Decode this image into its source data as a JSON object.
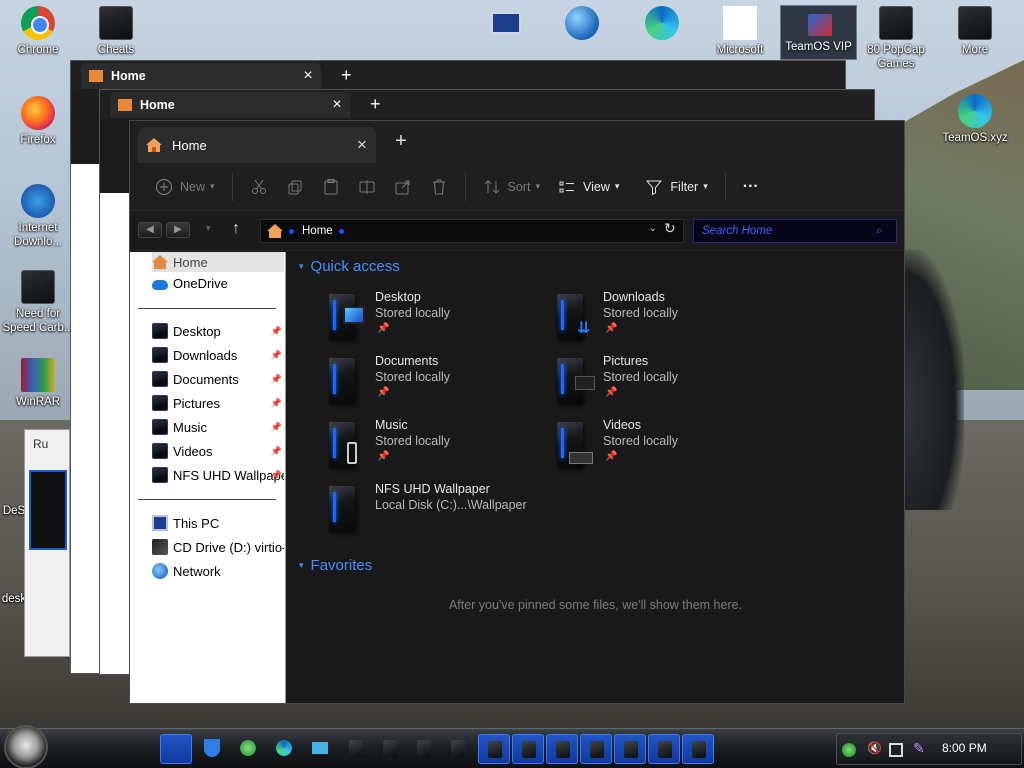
{
  "desktop": {
    "icons": [
      {
        "label": "Chrome",
        "glyph": "chrome"
      },
      {
        "label": "Cheats",
        "glyph": "pc"
      },
      {
        "label": "Firefox",
        "glyph": "ff"
      },
      {
        "label": "Internet Downlo...",
        "glyph": "ie"
      },
      {
        "label": "Need for Speed Carb...",
        "glyph": "pc"
      },
      {
        "label": "WinRAR",
        "glyph": "winrar"
      },
      {
        "label": "DeS",
        "glyph": "pc"
      },
      {
        "label": "desk",
        "glyph": "pc"
      },
      {
        "label": "Microsoft",
        "glyph": "ms"
      },
      {
        "label": "80 PopCap Games",
        "glyph": "pc"
      },
      {
        "label": "More",
        "glyph": "pc"
      },
      {
        "label": "TeamOS.xyz",
        "glyph": "edge"
      }
    ],
    "teamos_tile": "TeamOS VIP",
    "run_dialog_title": "Ru"
  },
  "window": {
    "tab_title": "Home",
    "background_tab_title": "Home",
    "toolbar": {
      "new": "New",
      "sort": "Sort",
      "view": "View",
      "filter": "Filter",
      "more": "···"
    },
    "address": {
      "crumb": "Home",
      "search_placeholder": "Search Home"
    },
    "sidebar": {
      "home": "Home",
      "onedrive": "OneDrive",
      "pinned": [
        "Desktop",
        "Downloads",
        "Documents",
        "Pictures",
        "Music",
        "Videos",
        "NFS UHD Wallpaper"
      ],
      "this_pc": "This PC",
      "cd_drive": "CD Drive (D:) virtio-win",
      "network": "Network"
    },
    "quick_access": {
      "header": "Quick access",
      "items": [
        {
          "name": "Desktop",
          "sub": "Stored locally"
        },
        {
          "name": "Downloads",
          "sub": "Stored locally"
        },
        {
          "name": "Documents",
          "sub": "Stored locally"
        },
        {
          "name": "Pictures",
          "sub": "Stored locally"
        },
        {
          "name": "Music",
          "sub": "Stored locally"
        },
        {
          "name": "Videos",
          "sub": "Stored locally"
        },
        {
          "name": "NFS UHD Wallpaper",
          "sub": "Local Disk (C:)...\\Wallpaper"
        }
      ]
    },
    "favorites": {
      "header": "Favorites",
      "empty": "After you've pinned some files, we'll show them here."
    }
  },
  "taskbar": {
    "clock": "8:00 PM"
  },
  "colors": {
    "accent": "#4a8cff",
    "search_text": "#3d63ff",
    "window_bg": "#191919"
  }
}
